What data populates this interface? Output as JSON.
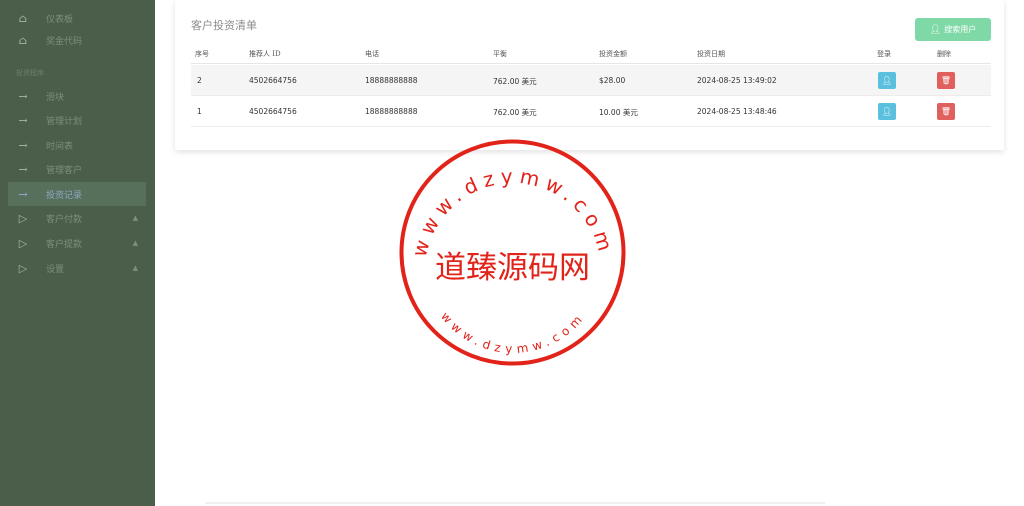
{
  "sidebar": {
    "items": [
      {
        "label": "仪表板",
        "icon": "home-icon"
      },
      {
        "label": "奖金代码",
        "icon": "home-icon"
      }
    ],
    "section_label": "投资程序",
    "sub_items": [
      {
        "label": "滑块"
      },
      {
        "label": "管理计划"
      },
      {
        "label": "时间表"
      },
      {
        "label": "管理客户"
      },
      {
        "label": "投资记录"
      }
    ],
    "groups": [
      {
        "label": "客户付款"
      },
      {
        "label": "客户提款"
      },
      {
        "label": "设置"
      }
    ]
  },
  "card": {
    "title": "客户投资清单",
    "search_label": "搜索用户"
  },
  "table": {
    "headers": [
      "序号",
      "推荐人 ID",
      "电话",
      "平衡",
      "投资金额",
      "投资日期",
      "登录",
      "删除"
    ],
    "rows": [
      {
        "no": "2",
        "ref_id": "4502664756",
        "phone": "18888888888",
        "balance": "762.00",
        "balance_unit": "美元",
        "amount": "$28.00",
        "amount_unit": "",
        "date": "2024-08-25 13:49:02"
      },
      {
        "no": "1",
        "ref_id": "4502664756",
        "phone": "18888888888",
        "balance": "762.00",
        "balance_unit": "美元",
        "amount": "10.00",
        "amount_unit": "美元",
        "date": "2024-08-25 13:48:46"
      }
    ]
  },
  "watermark": {
    "center_text": "道臻源码网",
    "ring_text": "www.dzymw.com"
  },
  "colors": {
    "sidebar_bg": "#4a5e49",
    "accent_green": "#7fd9a6",
    "login_blue": "#5bc0de",
    "delete_red": "#e0605e",
    "stamp_red": "#e2231a"
  }
}
